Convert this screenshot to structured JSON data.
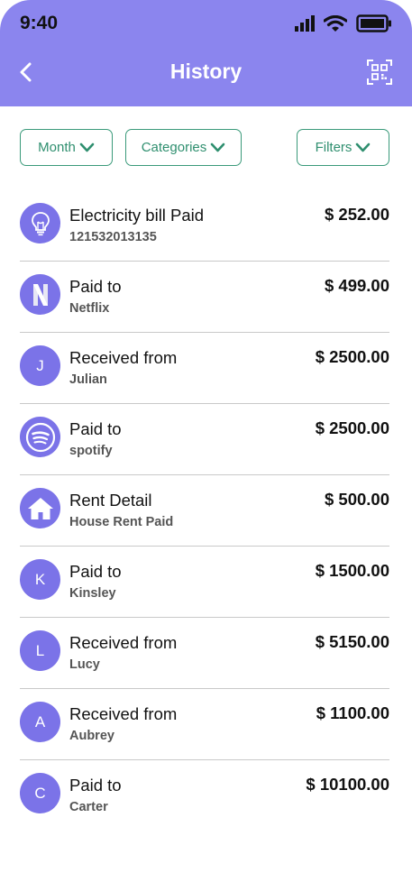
{
  "status": {
    "time": "9:40"
  },
  "header": {
    "title": "History"
  },
  "filters": {
    "month": "Month",
    "categories": "Categories",
    "filters": "Filters"
  },
  "colors": {
    "header_bg": "#8B85EE",
    "avatar_bg": "#7B73E8",
    "chip_border": "#3a9a7a"
  },
  "transactions": [
    {
      "icon": "bulb-icon",
      "title": "Electricity bill Paid",
      "subtitle": "121532013135",
      "amount": "$ 252.00"
    },
    {
      "icon": "netflix-logo",
      "title": "Paid to",
      "subtitle": "Netflix",
      "amount": "$ 499.00"
    },
    {
      "initial": "J",
      "title": "Received from",
      "subtitle": "Julian",
      "amount": "$ 2500.00"
    },
    {
      "icon": "spotify-logo",
      "title": "Paid to",
      "subtitle": "spotify",
      "amount": "$ 2500.00"
    },
    {
      "icon": "house-icon",
      "title": "Rent Detail",
      "subtitle": "House Rent Paid",
      "amount": "$ 500.00"
    },
    {
      "initial": "K",
      "title": "Paid to",
      "subtitle": "Kinsley",
      "amount": "$ 1500.00"
    },
    {
      "initial": "L",
      "title": "Received from",
      "subtitle": "Lucy",
      "amount": "$ 5150.00"
    },
    {
      "initial": "A",
      "title": "Received from",
      "subtitle": "Aubrey",
      "amount": "$ 1100.00"
    },
    {
      "initial": "C",
      "title": "Paid to",
      "subtitle": "Carter",
      "amount": "$ 10100.00"
    }
  ]
}
